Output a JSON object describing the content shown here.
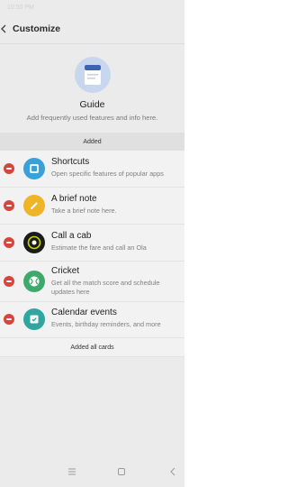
{
  "status": {
    "time": "10:50 PM"
  },
  "header": {
    "title": "Customize"
  },
  "guide": {
    "title": "Guide",
    "subtitle": "Add frequently used features and info here."
  },
  "section": {
    "added_label": "Added"
  },
  "cards": [
    {
      "title": "Shortcuts",
      "desc": "Open specific features of popular apps",
      "icon": "shortcuts-icon",
      "color": "#3aa0d8"
    },
    {
      "title": "A brief note",
      "desc": "Take a brief note here.",
      "icon": "note-pencil-icon",
      "color": "#f0b429"
    },
    {
      "title": "Call a cab",
      "desc": "Estimate the fare and call an Ola",
      "icon": "ola-cab-icon",
      "color": "#1b1b1b"
    },
    {
      "title": "Cricket",
      "desc": "Get all the match score and schedule updates here",
      "icon": "cricket-ball-icon",
      "color": "#3daa6c"
    },
    {
      "title": "Calendar events",
      "desc": "Events, birthday reminders, and more",
      "icon": "calendar-check-icon",
      "color": "#2fa6a0"
    }
  ],
  "footer": {
    "note": "Added all cards"
  },
  "colors": {
    "remove": "#d7463c",
    "panel_bg": "#ebebeb",
    "list_bg": "#f2f2f2"
  }
}
